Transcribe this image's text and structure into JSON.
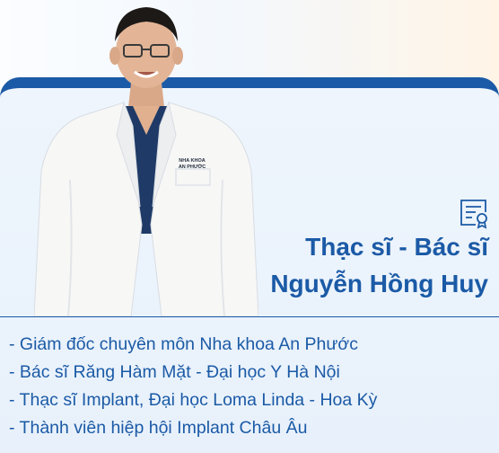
{
  "doctor": {
    "degree": "Thạc sĩ - Bác sĩ",
    "name": "Nguyễn Hồng Huy",
    "coat_badge_line1": "NHA KHOA",
    "coat_badge_line2": "AN PHƯỚC"
  },
  "credentials": [
    "- Giám đốc chuyên môn Nha khoa An Phước",
    "- Bác sĩ Răng Hàm Mặt - Đại học Y Hà Nội",
    "- Thạc sĩ Implant, Đại học Loma Linda - Hoa Kỳ",
    "- Thành viên hiệp hội Implant Châu Âu"
  ],
  "colors": {
    "accent": "#1b5aa6",
    "card_background": "#eaf2fb",
    "coat": "#f7f7f6",
    "scrubs": "#1f3a66"
  },
  "icons": {
    "certificate": "certificate-icon"
  }
}
